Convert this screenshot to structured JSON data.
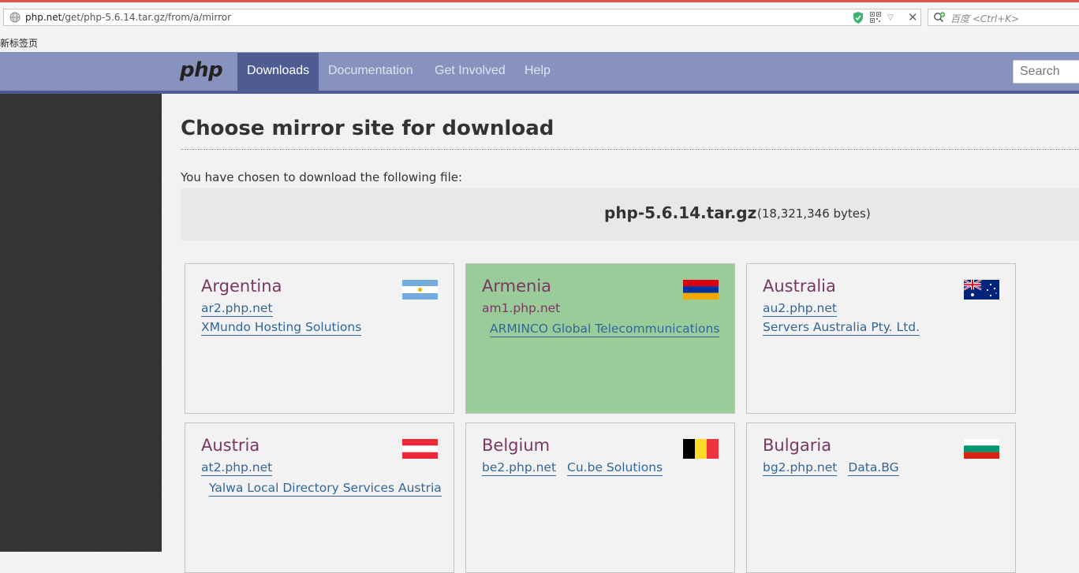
{
  "browser": {
    "url_host": "php.net",
    "url_path": "/get/php-5.6.14.tar.gz/from/a/mirror",
    "search_placeholder": "百度 <Ctrl+K>",
    "bookmark": "新标签页"
  },
  "nav": {
    "logo": "php",
    "items": [
      {
        "label": "Downloads",
        "active": true
      },
      {
        "label": "Documentation"
      },
      {
        "label": "Get Involved"
      },
      {
        "label": "Help"
      }
    ],
    "search_placeholder": "Search"
  },
  "page": {
    "title": "Choose mirror site for download",
    "intro": "You have chosen to download the following file:",
    "file_name": "php-5.6.14.tar.gz",
    "file_size": "(18,321,346 bytes)"
  },
  "mirrors": [
    {
      "country": "Argentina",
      "host": "ar2.php.net",
      "provider": "XMundo Hosting Solutions",
      "flag": "argentina-flag"
    },
    {
      "country": "Armenia",
      "host": "am1.php.net",
      "provider": "ARMINCO Global Telecommunications",
      "flag": "armenia-flag",
      "selected": true
    },
    {
      "country": "Australia",
      "host": "au2.php.net",
      "provider": "Servers Australia Pty. Ltd.",
      "flag": "australia-flag"
    },
    {
      "country": "Austria",
      "host": "at2.php.net",
      "provider": "Yalwa Local Directory Services Austria",
      "flag": "austria-flag"
    },
    {
      "country": "Belgium",
      "host": "be2.php.net",
      "provider": "Cu.be Solutions",
      "flag": "belgium-flag"
    },
    {
      "country": "Bulgaria",
      "host": "bg2.php.net",
      "provider": "Data.BG",
      "flag": "bulgaria-flag"
    }
  ],
  "colors": {
    "nav_bg": "#8892bf",
    "nav_active": "#4f5b93",
    "country_text": "#793862",
    "link": "#336699",
    "selected_card": "#99cc99"
  }
}
